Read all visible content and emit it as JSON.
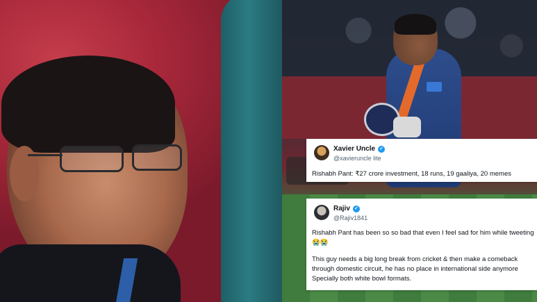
{
  "tweets": [
    {
      "name": "Xavier Uncle",
      "handle": "@xavieruncle lite",
      "text": "Rishabh Pant: ₹27 crore investment, 18 runs, 19 gaaliya, 20 memes",
      "avatar_icon": "profile-avatar"
    },
    {
      "name": "Rajiv",
      "handle": "@Rajiv1841",
      "paragraphs": [
        "Rishabh Pant has been so so bad that even I feel sad for him while tweeting😭😭",
        "This guy needs a big long break from cricket & then make a comeback through domestic circuit, he has no place in international side anymore Specially both white bowl formats."
      ],
      "avatar_icon": "profile-avatar"
    }
  ],
  "verified_icon": "verified-badge-icon",
  "colors": {
    "verified": "#1d9bf0",
    "card_bg": "#ffffff",
    "handle": "#536471"
  }
}
